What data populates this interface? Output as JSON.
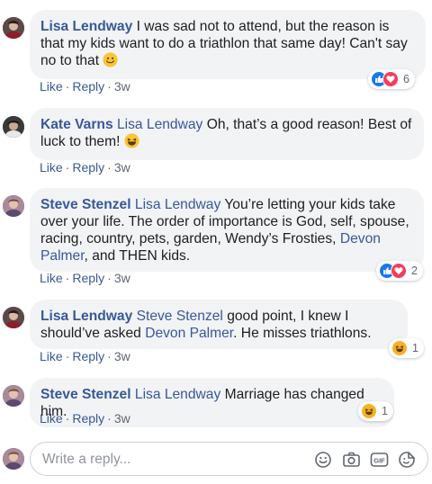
{
  "comments": [
    {
      "author": "Lisa Lendway",
      "mention": "",
      "text_parts": [
        "I was sad not to attend, but the reason is that my kids want to do a triathlon that same day! Can't say no to that"
      ],
      "emoji": "smile-icon",
      "actions": {
        "like": "Like",
        "reply": "Reply",
        "time": "3w"
      },
      "reactions": {
        "types": [
          "like",
          "love"
        ],
        "count": "6"
      }
    },
    {
      "author": "Kate Varns",
      "mention": "Lisa Lendway",
      "text_parts": [
        "Oh, that’s a good reason! Best of luck to them!"
      ],
      "emoji": "laugh-icon",
      "actions": {
        "like": "Like",
        "reply": "Reply",
        "time": "3w"
      },
      "reactions": null
    },
    {
      "author": "Steve Stenzel",
      "mention": "Lisa Lendway",
      "text_parts": [
        "You’re letting your kids take over your life. The order of importance is God, self, spouse, racing, country, pets, garden, Wendy’s Frosties,",
        ", and THEN kids."
      ],
      "inline_mention": "Devon Palmer",
      "actions": {
        "like": "Like",
        "reply": "Reply",
        "time": "3w"
      },
      "reactions": {
        "types": [
          "like",
          "love"
        ],
        "count": "2"
      }
    },
    {
      "author": "Lisa Lendway",
      "mention": "Steve Stenzel",
      "text_parts": [
        "good point, I knew I should’ve asked",
        ". He misses triathlons."
      ],
      "inline_mention": "Devon Palmer",
      "actions": {
        "like": "Like",
        "reply": "Reply",
        "time": "3w"
      },
      "reactions": {
        "types": [
          "haha"
        ],
        "count": "1"
      }
    },
    {
      "author": "Steve Stenzel",
      "mention": "Lisa Lendway",
      "text_parts": [
        "Marriage has changed him."
      ],
      "actions": {
        "like": "Like",
        "reply": "Reply",
        "time": "3w"
      },
      "reactions": {
        "types": [
          "haha"
        ],
        "count": "1"
      }
    }
  ],
  "reply_box": {
    "placeholder": "Write a reply...",
    "icons": [
      "emoji-icon",
      "camera-icon",
      "gif-icon",
      "sticker-icon"
    ]
  },
  "colors": {
    "link": "#385898",
    "bubble": "#f2f3f5",
    "like": "#1877f2",
    "love": "#f33e58",
    "haha": "#f7b125"
  }
}
